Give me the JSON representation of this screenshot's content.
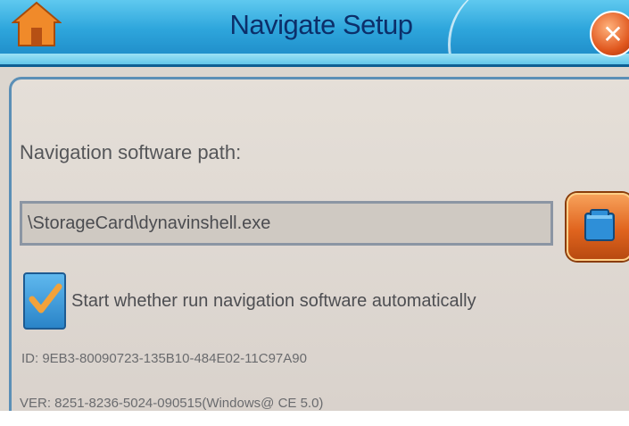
{
  "window": {
    "title": "Navigate Setup",
    "home_icon": "home-icon",
    "close_icon": "close-icon"
  },
  "setup": {
    "path_label": "Navigation software path:",
    "path_value": "\\StorageCard\\dynavinshell.exe",
    "browse_icon": "folder-icon",
    "auto_start_checked": true,
    "auto_start_label": "Start whether run navigation software automatically",
    "id_text": "ID:  9EB3-80090723-135B10-484E02-11C97A90",
    "ver_text": "VER:  8251-8236-5024-090515(Windows@ CE 5.0)"
  },
  "colors": {
    "title_bar": "#2ea6dc",
    "title_text": "#0c2f6a",
    "panel_border": "#5b8fb6",
    "accent_orange": "#e0641e",
    "check_blue": "#2a84c8"
  }
}
